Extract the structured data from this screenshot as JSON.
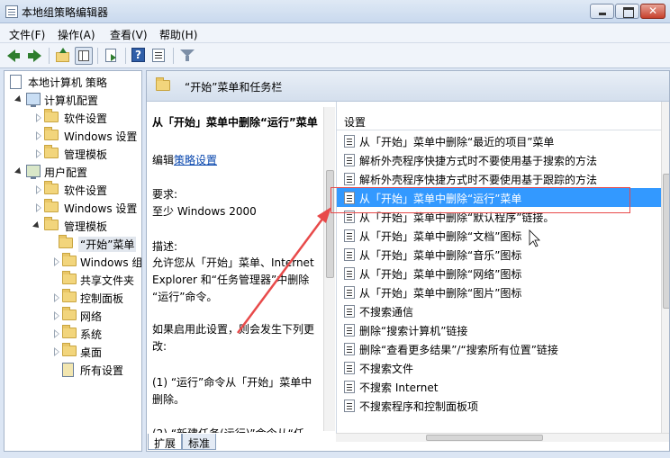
{
  "window": {
    "title": "本地组策略编辑器"
  },
  "menu": [
    "文件(F)",
    "操作(A)",
    "查看(V)",
    "帮助(H)"
  ],
  "toolbar": {
    "icons": [
      "back-icon",
      "forward-icon",
      "up-folder-icon",
      "show-tree-icon",
      "export-icon",
      "help-icon",
      "properties-icon",
      "filter-icon"
    ]
  },
  "tree": {
    "items": [
      {
        "label": "本地计算机 策略"
      },
      {
        "label": "计算机配置"
      },
      {
        "label": "软件设置"
      },
      {
        "label": "Windows 设置"
      },
      {
        "label": "管理模板"
      },
      {
        "label": "用户配置"
      },
      {
        "label": "软件设置"
      },
      {
        "label": "Windows 设置"
      },
      {
        "label": "管理模板"
      },
      {
        "label": "“开始”菜单"
      },
      {
        "label": "Windows 组"
      },
      {
        "label": "共享文件夹"
      },
      {
        "label": "控制面板"
      },
      {
        "label": "网络"
      },
      {
        "label": "系统"
      },
      {
        "label": "桌面"
      },
      {
        "label": "所有设置"
      }
    ]
  },
  "right_header": {
    "title": "“开始”菜单和任务栏"
  },
  "description": {
    "title": "从「开始」菜单中删除“运行”菜单",
    "edit_prefix": "编辑",
    "edit_link": "策略设置",
    "requirements_label": "要求:",
    "requirements_value": "至少 Windows 2000",
    "desc_label": "描述:",
    "desc_lines": [
      "允许您从「开始」菜单、Internet",
      "Explorer 和“任务管理器”中删除",
      "“运行”命令。"
    ],
    "if_enabled_lines": [
      "如果启用此设置，则会发生下列更",
      "改:"
    ],
    "item1_lines": [
      "(1) “运行”命令从「开始」菜单中",
      "删除。"
    ],
    "item2_partial": "(2) “新建任务(运行)”命令从“任"
  },
  "list": {
    "header": "设置",
    "rows": [
      "从「开始」菜单中删除“最近的项目”菜单",
      "解析外壳程序快捷方式时不要使用基于搜索的方法",
      "解析外壳程序快捷方式时不要使用基于跟踪的方法",
      "从「开始」菜单中删除“运行”菜单",
      "从「开始」菜单中删除“默认程序”链接。",
      "从「开始」菜单中删除“文档”图标",
      "从「开始」菜单中删除“音乐”图标",
      "从「开始」菜单中删除“网络”图标",
      "从「开始」菜单中删除“图片”图标",
      "不搜索通信",
      "删除“搜索计算机”链接",
      "删除“查看更多结果”/“搜索所有位置”链接",
      "不搜索文件",
      "不搜索 Internet",
      "不搜索程序和控制面板项"
    ],
    "selected_index": 3
  },
  "tabs": [
    "扩展",
    "标准"
  ],
  "colors": {
    "selection": "#3399ff",
    "annotation": "#e84a4a"
  }
}
